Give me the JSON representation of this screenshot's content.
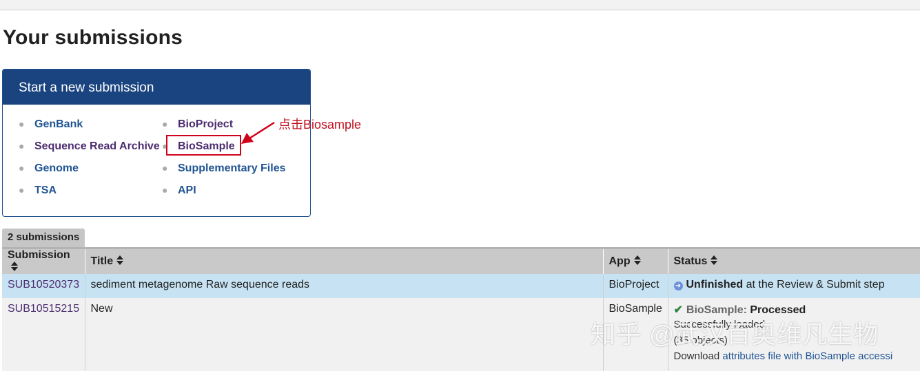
{
  "page": {
    "title": "Your submissions"
  },
  "new_submission": {
    "header": "Start a new submission",
    "links_left": [
      "GenBank",
      "Sequence Read Archive",
      "Genome",
      "TSA"
    ],
    "links_right": [
      "BioProject",
      "BioSample",
      "Supplementary Files",
      "API"
    ]
  },
  "annotation": {
    "text": "点击Biosample"
  },
  "submissions": {
    "tab_label": "2 submissions",
    "columns": [
      "Submission",
      "Title",
      "App",
      "Status"
    ],
    "rows": [
      {
        "id": "SUB10520373",
        "title": "sediment metagenome Raw sequence reads",
        "app": "BioProject",
        "status_bold": "Unfinished",
        "status_rest": " at the Review & Submit step"
      },
      {
        "id": "SUB10515215",
        "title": "New",
        "app": "BioSample",
        "status_app": "BioSample:",
        "status_state": "Processed",
        "line2": "Successfully loaded",
        "line3": "(35 objects)",
        "download_prefix": "Download ",
        "download_link": "attributes file with BioSample accessi"
      }
    ]
  },
  "watermark": "知乎 @武汉百奥维凡生物",
  "colors": {
    "header_bg": "#1a4480",
    "link": "#205493",
    "visited": "#4c2c6f",
    "highlight": "#d0021b",
    "row_selected": "#c7e3f3"
  }
}
